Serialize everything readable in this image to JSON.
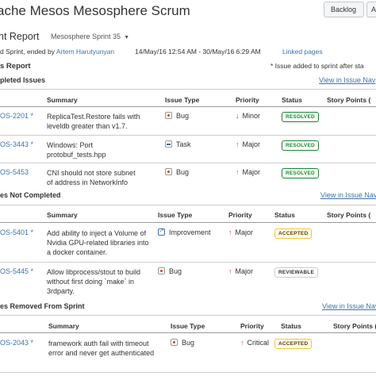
{
  "header": {
    "title": "ache Mesos Mesosphere Scrum",
    "buttons": [
      "Backlog",
      "Ac"
    ]
  },
  "report": {
    "title": "nt Report",
    "sprint_selector": "Mesosphere Sprint 35",
    "meta_prefix": "d Sprint, ended by",
    "meta_user": "Artem Harutyunyan",
    "meta_dates": "14/May/16 12:54 AM - 30/May/16 6:29 AM",
    "meta_link": "Linked pages",
    "section_title": "s Report",
    "note": "* Issue added to sprint after sta"
  },
  "columns": {
    "summary": "Summary",
    "issue_type": "Issue Type",
    "priority": "Priority",
    "status": "Status",
    "story_points": "Story Points ("
  },
  "sections": [
    {
      "title": "pleted Issues",
      "view_link": "View in Issue Nav",
      "rows": [
        {
          "key": "OS-2201 *",
          "summary": "ReplicaTest.Restore fails with leveldb greater than v1.7.",
          "type": "Bug",
          "type_icon": "bug-icon",
          "priority": "Minor",
          "priority_dir": "down",
          "status": "RESOLVED",
          "status_style": "resolved"
        },
        {
          "key": "OS-3443 *",
          "summary": "Windows: Port protobuf_tests.hpp",
          "type": "Task",
          "type_icon": "task-icon",
          "priority": "Major",
          "priority_dir": "up",
          "status": "RESOLVED",
          "status_style": "resolved"
        },
        {
          "key": "OS-5453",
          "summary": "CNI should not store subnet of address in NetworkInfo",
          "type": "Bug",
          "type_icon": "bug-icon",
          "priority": "Major",
          "priority_dir": "up",
          "status": "RESOLVED",
          "status_style": "resolved"
        }
      ]
    },
    {
      "title": "es Not Completed",
      "view_link": "View in Issue Nav",
      "rows": [
        {
          "key": "OS-5401 *",
          "summary": "Add ability to inject a Volume of Nvidia GPU-related libraries into a docker container.",
          "type": "Improvement",
          "type_icon": "improvement-icon",
          "priority": "Major",
          "priority_dir": "up",
          "status": "ACCEPTED",
          "status_style": "accepted"
        },
        {
          "key": "OS-5445 *",
          "summary": "Allow libprocess/stout to build without first doing `make` in 3rdparty.",
          "type": "Bug",
          "type_icon": "bug-icon",
          "priority": "Major",
          "priority_dir": "up",
          "status": "REVIEWABLE",
          "status_style": "reviewable"
        }
      ]
    },
    {
      "title": "es Removed From Sprint",
      "view_link": "View in Issue Nav",
      "rows": [
        {
          "key": "OS-2043 *",
          "summary": "framework auth fail with timeout error and never get authenticated",
          "type": "Bug",
          "type_icon": "bug-icon",
          "priority": "Critical",
          "priority_dir": "up",
          "status": "ACCEPTED",
          "status_style": "accepted"
        }
      ]
    }
  ]
}
